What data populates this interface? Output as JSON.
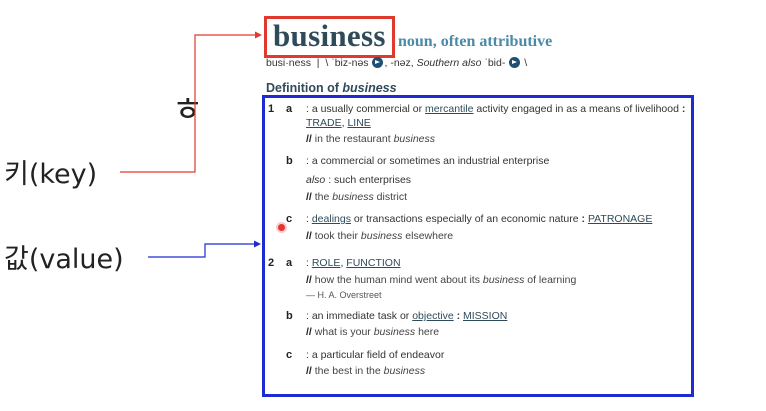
{
  "annotations": {
    "stray_char": "ㅎ",
    "key_label": "키(key)",
    "value_label": "값(value)",
    "colors": {
      "key_arrow": "#e03a2f",
      "value_arrow": "#1e2bd3"
    }
  },
  "entry": {
    "headword": "business",
    "part_of_speech": "noun, often attributive",
    "pron_syllables": "busi·ness",
    "pron_sep": "|",
    "pron_part1": "\\ ˈbiz-nəs",
    "pron_part2": ", -nəz,",
    "pron_region": "Southern",
    "pron_also": "also",
    "pron_part3": "ˈbid-",
    "pron_end": "\\",
    "audio_icon": "speaker-icon"
  },
  "definition": {
    "heading_prefix": "Definition of",
    "heading_word": "business",
    "senses": [
      {
        "number": "1",
        "letter": "a",
        "text_before": ": a usually commercial or",
        "xref1": "mercantile",
        "text_after": "activity engaged in as a means of livelihood",
        "syn_colon": ":",
        "syn1": "TRADE",
        "syn_sep": ",",
        "syn2": "LINE",
        "example_pre": "in the restaurant",
        "example_word": "business",
        "example_post": ""
      },
      {
        "letter": "b",
        "text": ": a commercial or sometimes an industrial enterprise",
        "also_label": "also",
        "also_text": ": such enterprises",
        "example_pre": "the",
        "example_word": "business",
        "example_post": "district"
      },
      {
        "letter": "c",
        "text_before": ":",
        "xref1": "dealings",
        "text_after": "or transactions especially of an economic nature",
        "syn_colon": ":",
        "syn1": "PATRONAGE",
        "example_pre": "took their",
        "example_word": "business",
        "example_post": "elsewhere"
      },
      {
        "number": "2",
        "letter": "a",
        "text_before": ":",
        "syn1": "ROLE",
        "syn_sep": ",",
        "syn2": "FUNCTION",
        "example_pre": "how the human mind went about its",
        "example_word": "business",
        "example_post": "of learning",
        "attribution": "— H. A. Overstreet"
      },
      {
        "letter": "b",
        "text_before": ": an immediate task or",
        "xref1": "objective",
        "syn_colon": ":",
        "syn1": "MISSION",
        "example_pre": "what is your",
        "example_word": "business",
        "example_post": "here"
      },
      {
        "letter": "c",
        "text": ": a particular field of endeavor",
        "example_pre": "the best in the",
        "example_word": "business",
        "example_post": ""
      }
    ],
    "example_marker": "//"
  }
}
